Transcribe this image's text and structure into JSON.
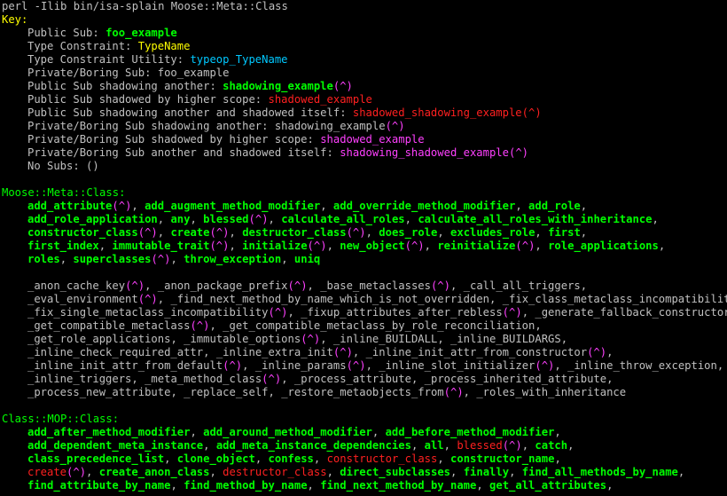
{
  "command": "perl -Ilib bin/isa-splain Moose::Meta::Class",
  "key": {
    "title": "Key:",
    "rows": [
      {
        "label": "Public Sub: ",
        "sample": "foo_example",
        "style": "g"
      },
      {
        "label": "Type Constraint: ",
        "sample": "TypeName",
        "style": "y"
      },
      {
        "label": "Type Constraint Utility: ",
        "sample": "typeop_TypeName",
        "style": "c"
      },
      {
        "label": "Private/Boring Sub: ",
        "sample": "foo_example",
        "style": "p"
      },
      {
        "label": "Public Sub shadowing another: ",
        "sample": "shadowing_example",
        "style": "g",
        "caret": "(^)",
        "caret_style": "m"
      },
      {
        "label": "Public Sub shadowed by higher scope: ",
        "sample": "shadowed_example",
        "style": "r"
      },
      {
        "label": "Public Sub shadowing another and shadowed itself: ",
        "sample": "shadowed_shadowing_example(^)",
        "style": "r"
      },
      {
        "label": "Private/Boring Sub shadowing another: ",
        "sample": "shadowing_example",
        "style": "p",
        "caret": "(^)",
        "caret_style": "m"
      },
      {
        "label": "Private/Boring Sub shadowed by higher scope: ",
        "sample": "shadowed_example",
        "style": "m"
      },
      {
        "label": "Private/Boring Sub another and shadowed itself: ",
        "sample": "shadowing_shadowed_example(^)",
        "style": "m"
      },
      {
        "label": "No Subs: ()",
        "sample": "",
        "style": "p"
      }
    ]
  },
  "sections": [
    {
      "header": "Moose::Meta::Class:",
      "public_lines": [
        [
          [
            "add_attribute",
            "g"
          ],
          [
            "(^)",
            "m"
          ],
          [
            ", ",
            "sep"
          ],
          [
            "add_augment_method_modifier",
            "g"
          ],
          [
            ", ",
            "sep"
          ],
          [
            "add_override_method_modifier",
            "g"
          ],
          [
            ", ",
            "sep"
          ],
          [
            "add_role",
            "g"
          ],
          [
            ",",
            "sep"
          ]
        ],
        [
          [
            "add_role_application",
            "g"
          ],
          [
            ", ",
            "sep"
          ],
          [
            "any",
            "g"
          ],
          [
            ", ",
            "sep"
          ],
          [
            "blessed",
            "g"
          ],
          [
            "(^)",
            "m"
          ],
          [
            ", ",
            "sep"
          ],
          [
            "calculate_all_roles",
            "g"
          ],
          [
            ", ",
            "sep"
          ],
          [
            "calculate_all_roles_with_inheritance",
            "g"
          ],
          [
            ",",
            "sep"
          ]
        ],
        [
          [
            "constructor_class",
            "g"
          ],
          [
            "(^)",
            "m"
          ],
          [
            ", ",
            "sep"
          ],
          [
            "create",
            "g"
          ],
          [
            "(^)",
            "m"
          ],
          [
            ", ",
            "sep"
          ],
          [
            "destructor_class",
            "g"
          ],
          [
            "(^)",
            "m"
          ],
          [
            ", ",
            "sep"
          ],
          [
            "does_role",
            "g"
          ],
          [
            ", ",
            "sep"
          ],
          [
            "excludes_role",
            "g"
          ],
          [
            ", ",
            "sep"
          ],
          [
            "first",
            "g"
          ],
          [
            ",",
            "sep"
          ]
        ],
        [
          [
            "first_index",
            "g"
          ],
          [
            ", ",
            "sep"
          ],
          [
            "immutable_trait",
            "g"
          ],
          [
            "(^)",
            "m"
          ],
          [
            ", ",
            "sep"
          ],
          [
            "initialize",
            "g"
          ],
          [
            "(^)",
            "m"
          ],
          [
            ", ",
            "sep"
          ],
          [
            "new_object",
            "g"
          ],
          [
            "(^)",
            "m"
          ],
          [
            ", ",
            "sep"
          ],
          [
            "reinitialize",
            "g"
          ],
          [
            "(^)",
            "m"
          ],
          [
            ", ",
            "sep"
          ],
          [
            "role_applications",
            "g"
          ],
          [
            ",",
            "sep"
          ]
        ],
        [
          [
            "roles",
            "g"
          ],
          [
            ", ",
            "sep"
          ],
          [
            "superclasses",
            "g"
          ],
          [
            "(^)",
            "m"
          ],
          [
            ", ",
            "sep"
          ],
          [
            "throw_exception",
            "g"
          ],
          [
            ", ",
            "sep"
          ],
          [
            "uniq",
            "g"
          ]
        ]
      ],
      "private_lines": [
        [
          [
            "_anon_cache_key",
            "p"
          ],
          [
            "(^)",
            "m"
          ],
          [
            ", ",
            "sep"
          ],
          [
            "_anon_package_prefix",
            "p"
          ],
          [
            "(^)",
            "m"
          ],
          [
            ", ",
            "sep"
          ],
          [
            "_base_metaclasses",
            "p"
          ],
          [
            "(^)",
            "m"
          ],
          [
            ", ",
            "sep"
          ],
          [
            "_call_all_triggers",
            "p"
          ],
          [
            ",",
            "sep"
          ]
        ],
        [
          [
            "_eval_environment",
            "p"
          ],
          [
            "(^)",
            "m"
          ],
          [
            ", ",
            "sep"
          ],
          [
            "_find_next_method_by_name_which_is_not_overridden",
            "p"
          ],
          [
            ", ",
            "sep"
          ],
          [
            "_fix_class_metaclass_incompatibility",
            "p"
          ],
          [
            "(^)",
            "m"
          ],
          [
            ",",
            "sep"
          ]
        ],
        [
          [
            "_fix_single_metaclass_incompatibility",
            "p"
          ],
          [
            "(^)",
            "m"
          ],
          [
            ", ",
            "sep"
          ],
          [
            "_fixup_attributes_after_rebless",
            "p"
          ],
          [
            "(^)",
            "m"
          ],
          [
            ", ",
            "sep"
          ],
          [
            "_generate_fallback_constructor",
            "p"
          ],
          [
            "(^)",
            "m"
          ],
          [
            ",",
            "sep"
          ]
        ],
        [
          [
            "_get_compatible_metaclass",
            "p"
          ],
          [
            "(^)",
            "m"
          ],
          [
            ", ",
            "sep"
          ],
          [
            "_get_compatible_metaclass_by_role_reconciliation",
            "p"
          ],
          [
            ",",
            "sep"
          ]
        ],
        [
          [
            "_get_role_applications",
            "p"
          ],
          [
            ", ",
            "sep"
          ],
          [
            "_immutable_options",
            "p"
          ],
          [
            "(^)",
            "m"
          ],
          [
            ", ",
            "sep"
          ],
          [
            "_inline_BUILDALL",
            "p"
          ],
          [
            ", ",
            "sep"
          ],
          [
            "_inline_BUILDARGS",
            "p"
          ],
          [
            ",",
            "sep"
          ]
        ],
        [
          [
            "_inline_check_required_attr",
            "p"
          ],
          [
            ", ",
            "sep"
          ],
          [
            "_inline_extra_init",
            "p"
          ],
          [
            "(^)",
            "m"
          ],
          [
            ", ",
            "sep"
          ],
          [
            "_inline_init_attr_from_constructor",
            "p"
          ],
          [
            "(^)",
            "m"
          ],
          [
            ",",
            "sep"
          ]
        ],
        [
          [
            "_inline_init_attr_from_default",
            "p"
          ],
          [
            "(^)",
            "m"
          ],
          [
            ", ",
            "sep"
          ],
          [
            "_inline_params",
            "p"
          ],
          [
            "(^)",
            "m"
          ],
          [
            ", ",
            "sep"
          ],
          [
            "_inline_slot_initializer",
            "p"
          ],
          [
            "(^)",
            "m"
          ],
          [
            ", ",
            "sep"
          ],
          [
            "_inline_throw_exception",
            "p"
          ],
          [
            ",",
            "sep"
          ]
        ],
        [
          [
            "_inline_triggers",
            "p"
          ],
          [
            ", ",
            "sep"
          ],
          [
            "_meta_method_class",
            "p"
          ],
          [
            "(^)",
            "m"
          ],
          [
            ", ",
            "sep"
          ],
          [
            "_process_attribute",
            "p"
          ],
          [
            ", ",
            "sep"
          ],
          [
            "_process_inherited_attribute",
            "p"
          ],
          [
            ",",
            "sep"
          ]
        ],
        [
          [
            "_process_new_attribute",
            "p"
          ],
          [
            ", ",
            "sep"
          ],
          [
            "_replace_self",
            "p"
          ],
          [
            ", ",
            "sep"
          ],
          [
            "_restore_metaobjects_from",
            "p"
          ],
          [
            "(^)",
            "m"
          ],
          [
            ", ",
            "sep"
          ],
          [
            "_roles_with_inheritance",
            "p"
          ]
        ]
      ]
    },
    {
      "header": "Class::MOP::Class:",
      "public_lines": [
        [
          [
            "add_after_method_modifier",
            "g"
          ],
          [
            ", ",
            "sep"
          ],
          [
            "add_around_method_modifier",
            "g"
          ],
          [
            ", ",
            "sep"
          ],
          [
            "add_before_method_modifier",
            "g"
          ],
          [
            ",",
            "sep"
          ]
        ],
        [
          [
            "add_dependent_meta_instance",
            "g"
          ],
          [
            ", ",
            "sep"
          ],
          [
            "add_meta_instance_dependencies",
            "g"
          ],
          [
            ", ",
            "sep"
          ],
          [
            "all",
            "g"
          ],
          [
            ", ",
            "sep"
          ],
          [
            "blessed",
            "r"
          ],
          [
            "(^)",
            "m"
          ],
          [
            ", ",
            "sep"
          ],
          [
            "catch",
            "g"
          ],
          [
            ",",
            "sep"
          ]
        ],
        [
          [
            "class_precedence_list",
            "g"
          ],
          [
            ", ",
            "sep"
          ],
          [
            "clone_object",
            "g"
          ],
          [
            ", ",
            "sep"
          ],
          [
            "confess",
            "g"
          ],
          [
            ", ",
            "sep"
          ],
          [
            "constructor_class",
            "r"
          ],
          [
            ", ",
            "sep"
          ],
          [
            "constructor_name",
            "g"
          ],
          [
            ",",
            "sep"
          ]
        ],
        [
          [
            "create",
            "r"
          ],
          [
            "(^)",
            "m"
          ],
          [
            ", ",
            "sep"
          ],
          [
            "create_anon_class",
            "g"
          ],
          [
            ", ",
            "sep"
          ],
          [
            "destructor_class",
            "r"
          ],
          [
            ", ",
            "sep"
          ],
          [
            "direct_subclasses",
            "g"
          ],
          [
            ", ",
            "sep"
          ],
          [
            "finally",
            "g"
          ],
          [
            ", ",
            "sep"
          ],
          [
            "find_all_methods_by_name",
            "g"
          ],
          [
            ",",
            "sep"
          ]
        ],
        [
          [
            "find_attribute_by_name",
            "g"
          ],
          [
            ", ",
            "sep"
          ],
          [
            "find_method_by_name",
            "g"
          ],
          [
            ", ",
            "sep"
          ],
          [
            "find_next_method_by_name",
            "g"
          ],
          [
            ", ",
            "sep"
          ],
          [
            "get_all_attributes",
            "g"
          ],
          [
            ",",
            "sep"
          ]
        ]
      ],
      "private_lines": []
    }
  ]
}
